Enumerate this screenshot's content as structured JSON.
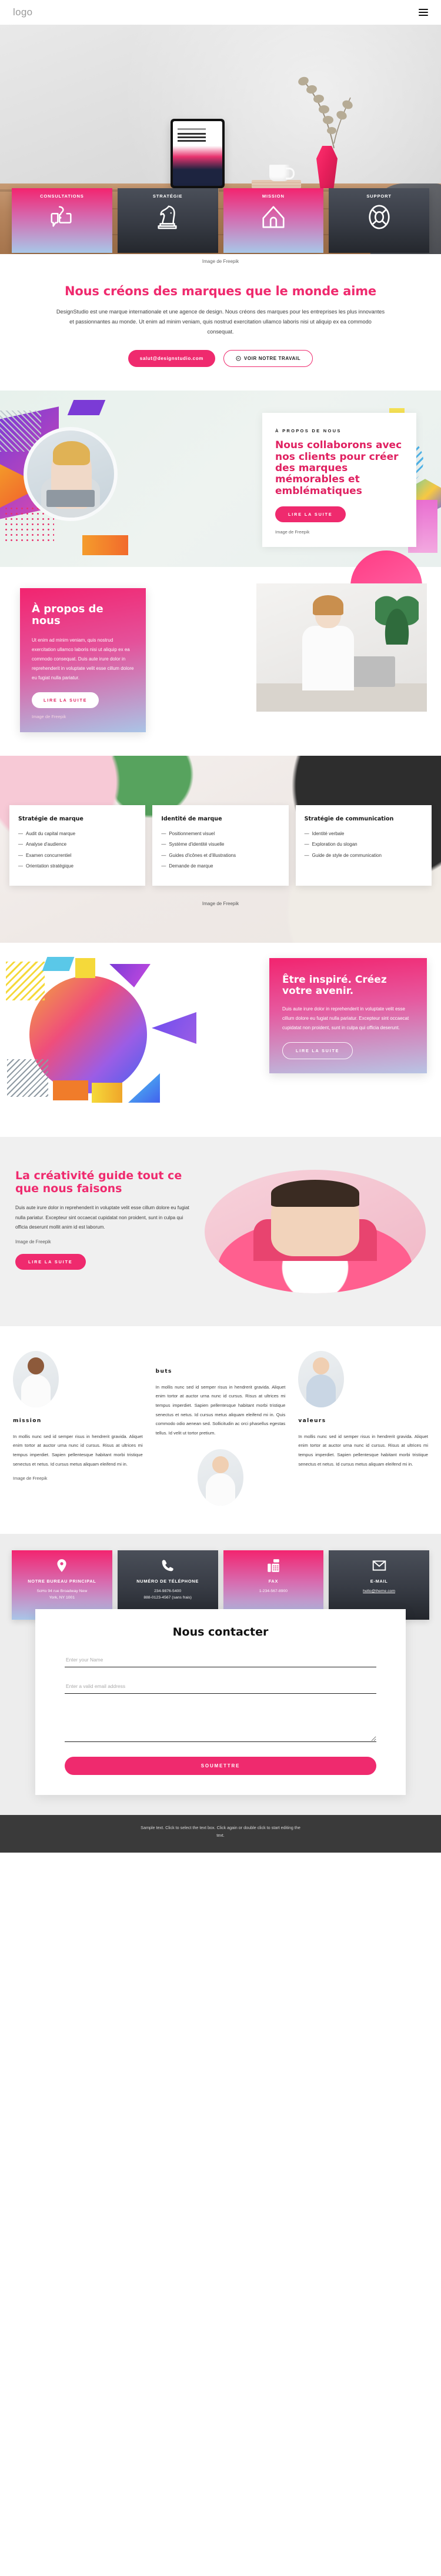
{
  "header": {
    "logo": "logo",
    "menu_icon": "hamburger-menu-icon"
  },
  "hero": {
    "credit": "Image de Freepik",
    "credit_link": "Freepik"
  },
  "cards": [
    {
      "title": "CONSULTATIONS",
      "icon": "question-chat-icon",
      "theme": "pink"
    },
    {
      "title": "STRATÉGIE",
      "icon": "chess-knight-icon",
      "theme": "dark"
    },
    {
      "title": "MISSION",
      "icon": "house-icon",
      "theme": "pink"
    },
    {
      "title": "SUPPORT",
      "icon": "lifebuoy-icon",
      "theme": "dark"
    }
  ],
  "intro": {
    "heading": "Nous créons des marques que le monde aime",
    "paragraph": "DesignStudio est une marque internationale et une agence de design. Nous créons des marques pour les entreprises les plus innovantes et passionnantes au monde. Ut enim ad minim veniam, quis nostrud exercitation ullamco laboris nisi ut aliquip ex ea commodo consequat.",
    "email_button": "salut@designstudio.com",
    "work_button": "VOIR NOTRE TRAVAIL"
  },
  "about_geo": {
    "eyebrow": "À PROPOS DE NOUS",
    "heading": "Nous collaborons avec nos clients pour créer des marques mémorables et emblématiques",
    "cta": "LIRE LA SUITE",
    "credit": "Image de Freepik"
  },
  "about_split": {
    "heading": "À propos de nous",
    "paragraph": "Ut enim ad minim veniam, quis nostrud exercitation ullamco laboris nisi ut aliquip ex ea commodo consequat. Duis aute irure dolor in reprehenderit in voluptate velit esse cillum dolore eu fugiat nulla pariatur.",
    "cta": "LIRE LA SUITE",
    "credit": "Image de Freepik"
  },
  "services": {
    "credit": "Image de Freepik",
    "columns": [
      {
        "title": "Stratégie de marque",
        "items": [
          "Audit du capital marque",
          "Analyse d'audience",
          "Examen concurrentiel",
          "Orientation stratégique"
        ]
      },
      {
        "title": "Identité de marque",
        "items": [
          "Positionnement visuel",
          "Système d'identité visuelle",
          "Guides d'icônes et d'illustrations",
          "Demande de marque"
        ]
      },
      {
        "title": "Stratégie de communication",
        "items": [
          "Identité verbale",
          "Exploration du slogan",
          "Guide de style de communication"
        ]
      }
    ]
  },
  "inspire": {
    "heading": "Être inspiré. Créez votre avenir.",
    "paragraph": "Duis aute irure dolor in reprehenderit in voluptate velit esse cillum dolore eu fugiat nulla pariatur. Excepteur sint occaecat cupidatat non proident, sunt in culpa qui officia deserunt.",
    "cta": "LIRE LA SUITE"
  },
  "creativity": {
    "heading": "La créativité guide tout ce que nous faisons",
    "paragraph": "Duis aute irure dolor in reprehenderit in voluptate velit esse cillum dolore eu fugiat nulla pariatur. Excepteur sint occaecat cupidatat non proident, sunt in culpa qui officia deserunt mollit anim id est laborum.",
    "credit": "Image de Freepik",
    "cta": "LIRE LA SUITE"
  },
  "mbv": {
    "mission": {
      "title": "mission",
      "paragraph": "In mollis nunc sed id semper risus in hendrerit gravida. Aliquet enim tortor at auctor urna nunc id cursus. Risus at ultrices mi tempus imperdiet. Sapien pellentesque habitant morbi tristique senectus et netus. Id cursus metus aliquam eleifend mi in.",
      "credit": "Image de Freepik"
    },
    "buts": {
      "title": "buts",
      "paragraph": "In mollis nunc sed id semper risus in hendrerit gravida. Aliquet enim tortor at auctor urna nunc id cursus. Risus at ultrices mi tempus imperdiet. Sapien pellentesque habitant morbi tristique senectus et netus. Id cursus metus aliquam eleifend mi in. Quis commodo odio aenean sed. Sollicitudin ac orci phasellus egestas tellus. Id velit ut tortor pretium."
    },
    "valeurs": {
      "title": "valeurs",
      "paragraph": "In mollis nunc sed id semper risus in hendrerit gravida. Aliquet enim tortor at auctor urna nunc id cursus. Risus at ultrices mi tempus imperdiet. Sapien pellentesque habitant morbi tristique senectus et netus. Id cursus metus aliquam eleifend mi in."
    }
  },
  "contact_cards": [
    {
      "icon": "map-pin-icon",
      "title": "NOTRE BUREAU PRINCIPAL",
      "line1": "SoHo 94 rue Broadway New",
      "line2": "York, NY 1001",
      "theme": "pink",
      "underline": false
    },
    {
      "icon": "phone-icon",
      "title": "NUMÉRO DE TÉLÉPHONE",
      "line1": "234-9876-5400",
      "line2": "888-0123-4567 (sans frais)",
      "theme": "dark",
      "underline": false
    },
    {
      "icon": "fax-icon",
      "title": "FAX",
      "line1": "1-234-567-8900",
      "line2": "",
      "theme": "pink",
      "underline": false
    },
    {
      "icon": "envelope-icon",
      "title": "E-MAIL",
      "line1": "hello@theme.com",
      "line2": "",
      "theme": "dark",
      "underline": true
    }
  ],
  "form": {
    "title": "Nous contacter",
    "name_placeholder": "Enter your Name",
    "email_placeholder": "Enter a valid email address",
    "message_placeholder": "",
    "submit": "SOUMETTRE"
  },
  "footer": {
    "text": "Sample text. Click to select the text box. Click again or double click to start editing the text."
  }
}
